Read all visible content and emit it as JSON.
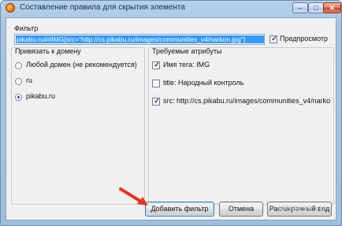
{
  "window": {
    "title": "Составление правила для скрытия элемента",
    "min_glyph": "–",
    "max_glyph": "□",
    "close_glyph": "✕"
  },
  "filter": {
    "label": "Фильтр",
    "value": "pikabu.ru##IMG[src=\"http://cs.pikabu.ru/images/communities_v4/narkon.jpg\"]",
    "preview_label": "Предпросмотр",
    "preview_checked": true
  },
  "domain": {
    "title": "Привязать к домену",
    "options": [
      {
        "label": "Любой домен (не рекомендуется)",
        "selected": false
      },
      {
        "label": "ru",
        "selected": false
      },
      {
        "label": "pikabu.ru",
        "selected": true
      }
    ]
  },
  "attributes": {
    "title": "Требуемые атрибуты",
    "items": [
      {
        "label": "Имя тега: IMG",
        "checked": true
      },
      {
        "label": "title: Народный контроль",
        "checked": false
      },
      {
        "label": "src: http://cs.pikabu.ru/images/communities_v4/narko",
        "checked": true
      }
    ]
  },
  "buttons": {
    "add": "Добавить фильтр",
    "cancel": "Отмена",
    "advanced": "Расширенный вид"
  },
  "watermark": "lzbavsa.ru",
  "colors": {
    "selection": "#3399ff",
    "arrow": "#e8321c"
  },
  "icons": {
    "check": "✓"
  }
}
